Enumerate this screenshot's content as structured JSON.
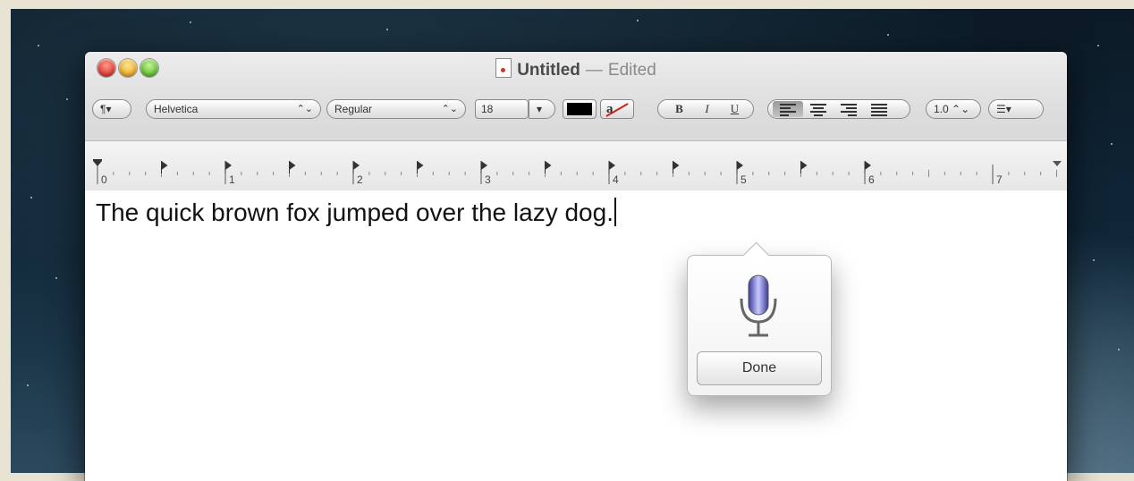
{
  "window": {
    "title_name": "Untitled",
    "title_separator": "—",
    "title_status": "Edited"
  },
  "toolbar": {
    "paragraph_label": "¶▾",
    "font": "Helvetica",
    "font_style": "Regular",
    "font_size": "18",
    "popup_arrow": "⌃⌄",
    "size_arrow": "▾",
    "highlight_glyph": "a",
    "bold": "B",
    "italic": "I",
    "underline": "U",
    "line_spacing": "1.0 ⌃⌄",
    "list_label": "☰▾"
  },
  "ruler": {
    "labels": [
      "0",
      "1",
      "2",
      "3",
      "4",
      "5",
      "6",
      "7"
    ]
  },
  "document": {
    "text": "The quick brown fox jumped over the lazy dog."
  },
  "dictation": {
    "done_label": "Done"
  },
  "colors": {
    "text_color": "#000000",
    "mic_color": "#6a6ad8"
  }
}
